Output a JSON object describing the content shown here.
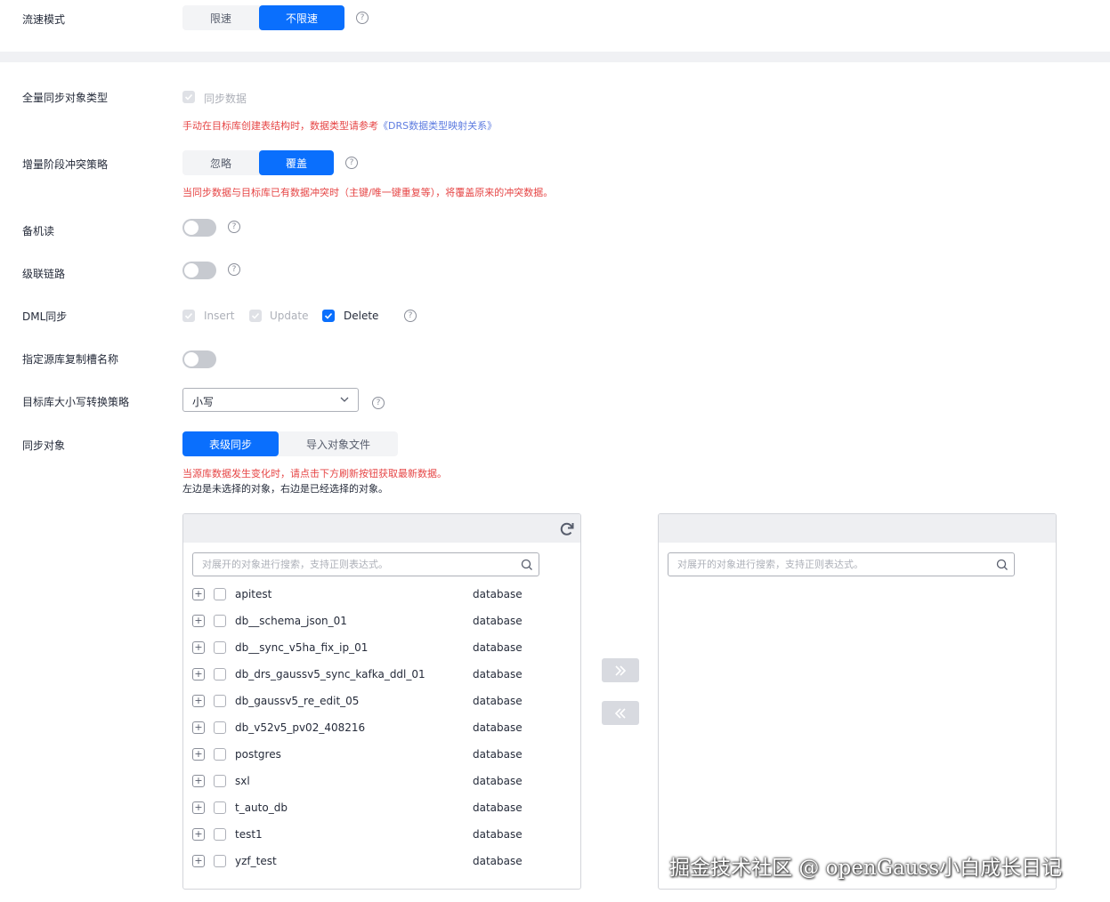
{
  "flow_mode": {
    "label": "流速模式",
    "options": [
      "限速",
      "不限速"
    ],
    "selected": "不限速"
  },
  "full_sync_type": {
    "label": "全量同步对象类型",
    "checkbox_label": "同步数据",
    "note_text": "手动在目标库创建表结构时，数据类型请参考",
    "note_link": "《DRS数据类型映射关系》"
  },
  "conflict_policy": {
    "label": "增量阶段冲突策略",
    "options": [
      "忽略",
      "覆盖"
    ],
    "selected": "覆盖",
    "note": "当同步数据与目标库已有数据冲突时（主键/唯一键重复等），将覆盖原来的冲突数据。"
  },
  "standby_read": {
    "label": "备机读",
    "enabled": false
  },
  "cascade_link": {
    "label": "级联链路",
    "enabled": false
  },
  "dml_sync": {
    "label": "DML同步",
    "options": [
      {
        "label": "Insert",
        "checked": true,
        "disabled": true
      },
      {
        "label": "Update",
        "checked": true,
        "disabled": true
      },
      {
        "label": "Delete",
        "checked": true,
        "disabled": false
      }
    ]
  },
  "replication_slot": {
    "label": "指定源库复制槽名称",
    "enabled": false
  },
  "case_policy": {
    "label": "目标库大小写转换策略",
    "value": "小写"
  },
  "sync_objects": {
    "label": "同步对象",
    "options": [
      "表级同步",
      "导入对象文件"
    ],
    "selected": "表级同步",
    "note_red": "当源库数据发生变化时，请点击下方刷新按钮获取最新数据。",
    "note_black": "左边是未选择的对象，右边是已经选择的对象。"
  },
  "left_panel": {
    "search_placeholder": "对展开的对象进行搜索，支持正则表达式。",
    "items": [
      {
        "name": "apitest",
        "type": "database"
      },
      {
        "name": "db__schema_json_01",
        "type": "database"
      },
      {
        "name": "db__sync_v5ha_fix_ip_01",
        "type": "database"
      },
      {
        "name": "db_drs_gaussv5_sync_kafka_ddl_01",
        "type": "database"
      },
      {
        "name": "db_gaussv5_re_edit_05",
        "type": "database"
      },
      {
        "name": "db_v52v5_pv02_408216",
        "type": "database"
      },
      {
        "name": "postgres",
        "type": "database"
      },
      {
        "name": "sxl",
        "type": "database"
      },
      {
        "name": "t_auto_db",
        "type": "database"
      },
      {
        "name": "test1",
        "type": "database"
      },
      {
        "name": "yzf_test",
        "type": "database"
      }
    ]
  },
  "right_panel": {
    "search_placeholder": "对展开的对象进行搜索，支持正则表达式。"
  },
  "watermark": "掘金技术社区 @ openGauss小白成长日记",
  "colors": {
    "primary": "#0a6ffd",
    "warning_text": "#e64545",
    "link": "#5e7ce0"
  }
}
